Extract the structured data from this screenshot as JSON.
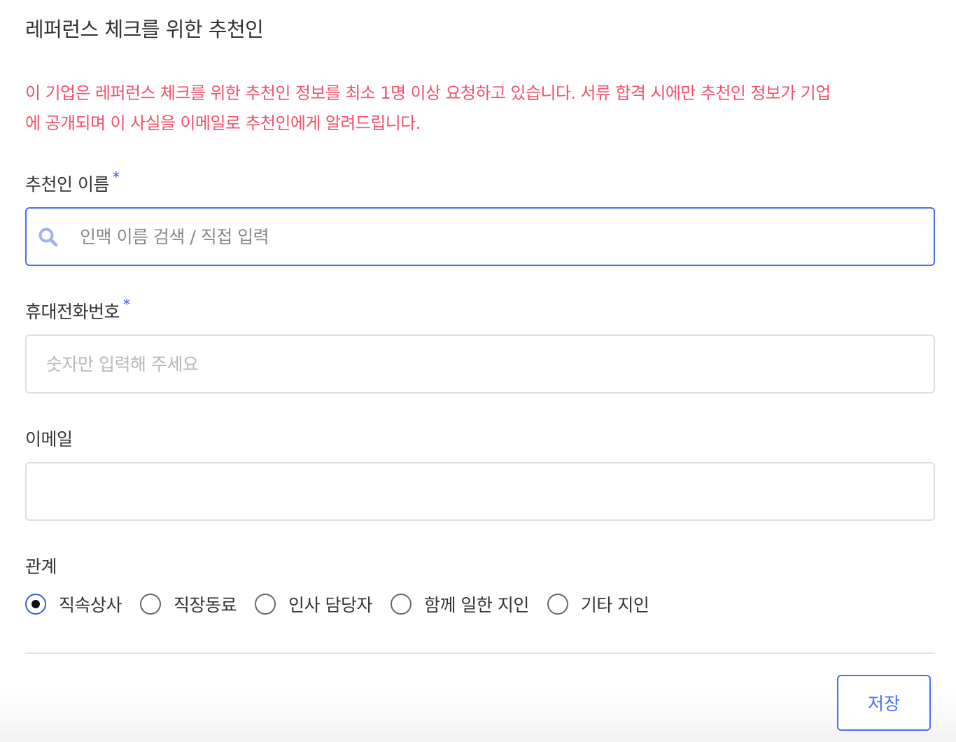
{
  "page": {
    "title": "레퍼런스 체크를 위한 추천인",
    "notice_line1": "이 기업은 레퍼런스 체크를 위한 추천인 정보를 최소 1명 이상 요청하고 있습니다. 서류 합격 시에만 추천인 정보가 기업",
    "notice_line2": "에 공개되며 이 사실을 이메일로 추천인에게 알려드립니다."
  },
  "fields": {
    "name": {
      "label": "추천인 이름",
      "required_mark": "*",
      "placeholder": "인맥 이름 검색 / 직접 입력",
      "value": "",
      "icon": "search-icon"
    },
    "phone": {
      "label": "휴대전화번호",
      "required_mark": "*",
      "placeholder": "숫자만 입력해 주세요",
      "value": ""
    },
    "email": {
      "label": "이메일",
      "placeholder": "",
      "value": ""
    }
  },
  "relation": {
    "label": "관계",
    "selected": "직속상사",
    "options": [
      {
        "label": "직속상사",
        "checked": true
      },
      {
        "label": "직장동료",
        "checked": false
      },
      {
        "label": "인사 담당자",
        "checked": false
      },
      {
        "label": "함께 일한 지인",
        "checked": false
      },
      {
        "label": "기타 지인",
        "checked": false
      }
    ]
  },
  "actions": {
    "save_label": "저장"
  },
  "colors": {
    "accent": "#4c6ef5",
    "notice": "#f2516a",
    "text": "#333333",
    "border": "#dedede"
  }
}
